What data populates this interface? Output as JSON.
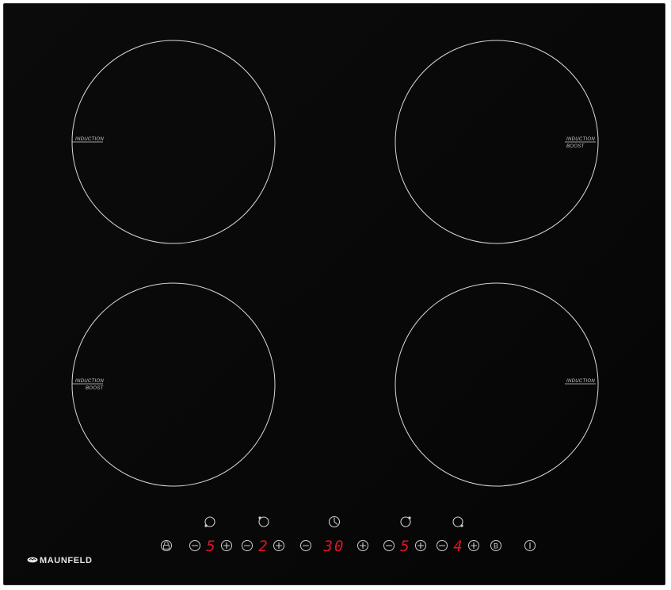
{
  "brand": {
    "name": "MAUNFELD"
  },
  "zones": [
    {
      "id": "rear-left",
      "line1": "INDUCTION",
      "line2": ""
    },
    {
      "id": "rear-right",
      "line1": "INDUCTION",
      "line2": "BOOST"
    },
    {
      "id": "front-left",
      "line1": "INDUCTION",
      "line2": "BOOST"
    },
    {
      "id": "front-right",
      "line1": "INDUCTION",
      "line2": ""
    }
  ],
  "controls": {
    "lock_icon": "lock-icon",
    "boost_label": "B",
    "power_icon": "power-icon",
    "zone_indicators": [
      "front-left-zone-icon",
      "rear-left-zone-icon",
      "timer-icon",
      "rear-right-zone-icon",
      "front-right-zone-icon"
    ],
    "displays": {
      "zone1": "5",
      "zone2": "2",
      "timer": "30",
      "zone3": "5",
      "zone4": "4"
    }
  },
  "colors": {
    "glass": "#080808",
    "ring": "#d9d9d9",
    "display": "#e1132b"
  }
}
